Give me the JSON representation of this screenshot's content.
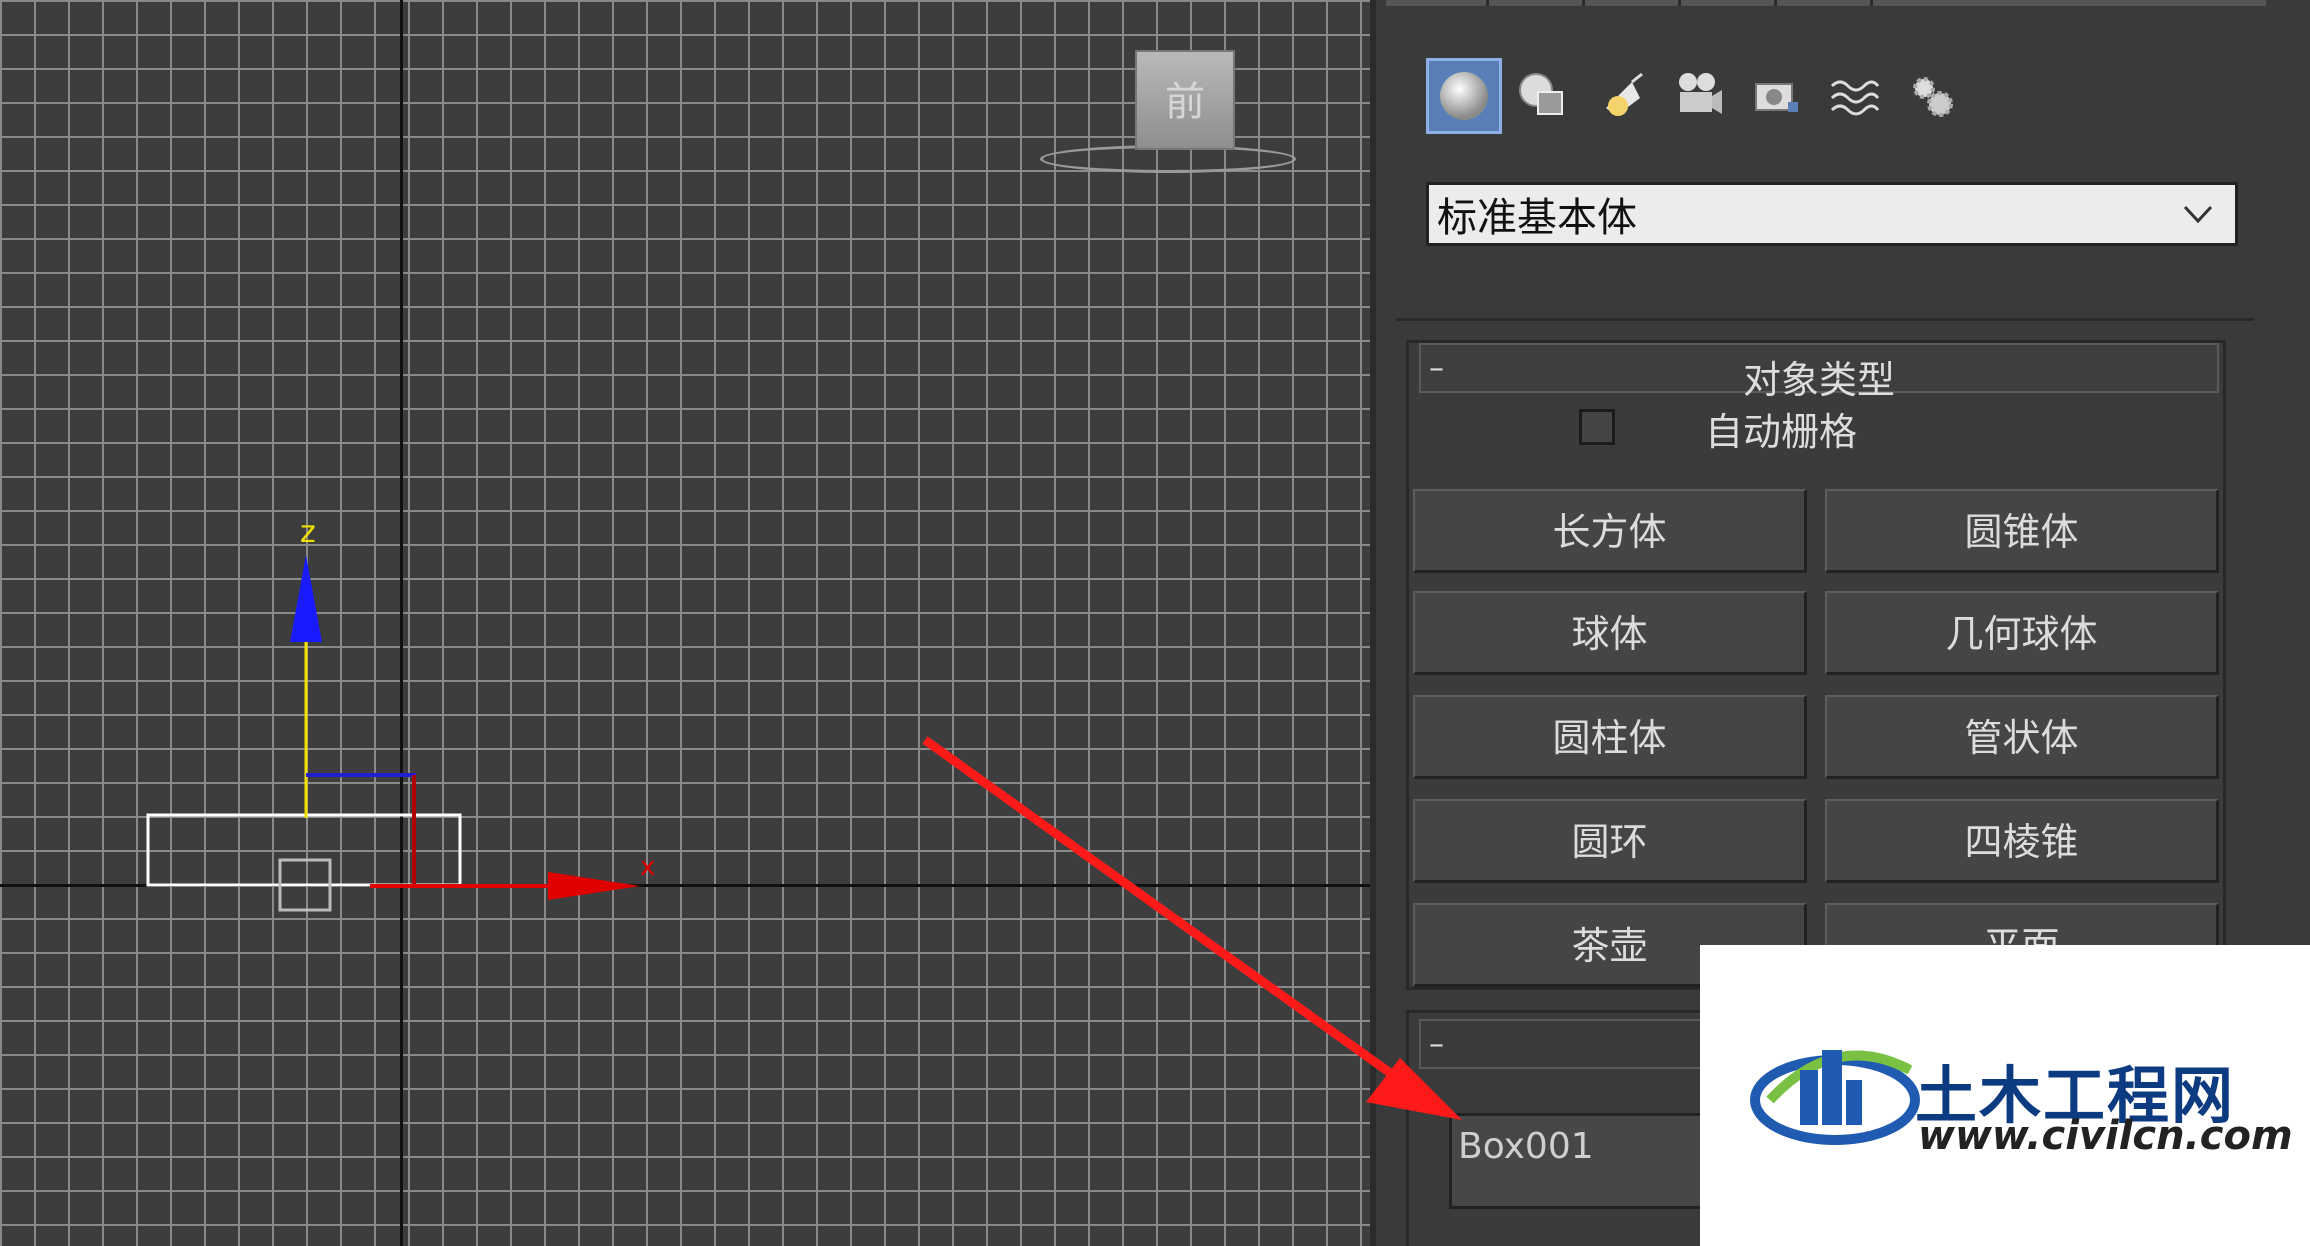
{
  "viewport": {
    "viewcube_label": "前",
    "axis_labels": {
      "z": "z",
      "x": "x"
    }
  },
  "panel": {
    "create_icons": [
      {
        "name": "geometry-sphere-icon",
        "active": true
      },
      {
        "name": "shapes-icon",
        "active": false
      },
      {
        "name": "lights-icon",
        "active": false
      },
      {
        "name": "cameras-icon",
        "active": false
      },
      {
        "name": "helpers-icon",
        "active": false
      },
      {
        "name": "space-warps-icon",
        "active": false
      },
      {
        "name": "systems-icon",
        "active": false
      }
    ],
    "category_dropdown": {
      "value": "标准基本体"
    },
    "object_type": {
      "collapse_symbol": "–",
      "title": "对象类型",
      "autogrid_label": "自动栅格",
      "buttons": [
        "长方体",
        "圆锥体",
        "球体",
        "几何球体",
        "圆柱体",
        "管状体",
        "圆环",
        "四棱锥",
        "茶壶",
        "平面"
      ]
    },
    "name_color": {
      "collapse_symbol": "–",
      "name_value": "Box001"
    }
  },
  "watermark": {
    "title": "土木工程网",
    "url": "www.civilcn.com"
  },
  "colors": {
    "z_axis": "#f0e000",
    "x_axis": "#e00000",
    "arrow": "#ff1a1a",
    "active_icon": "#5a7fb8"
  }
}
